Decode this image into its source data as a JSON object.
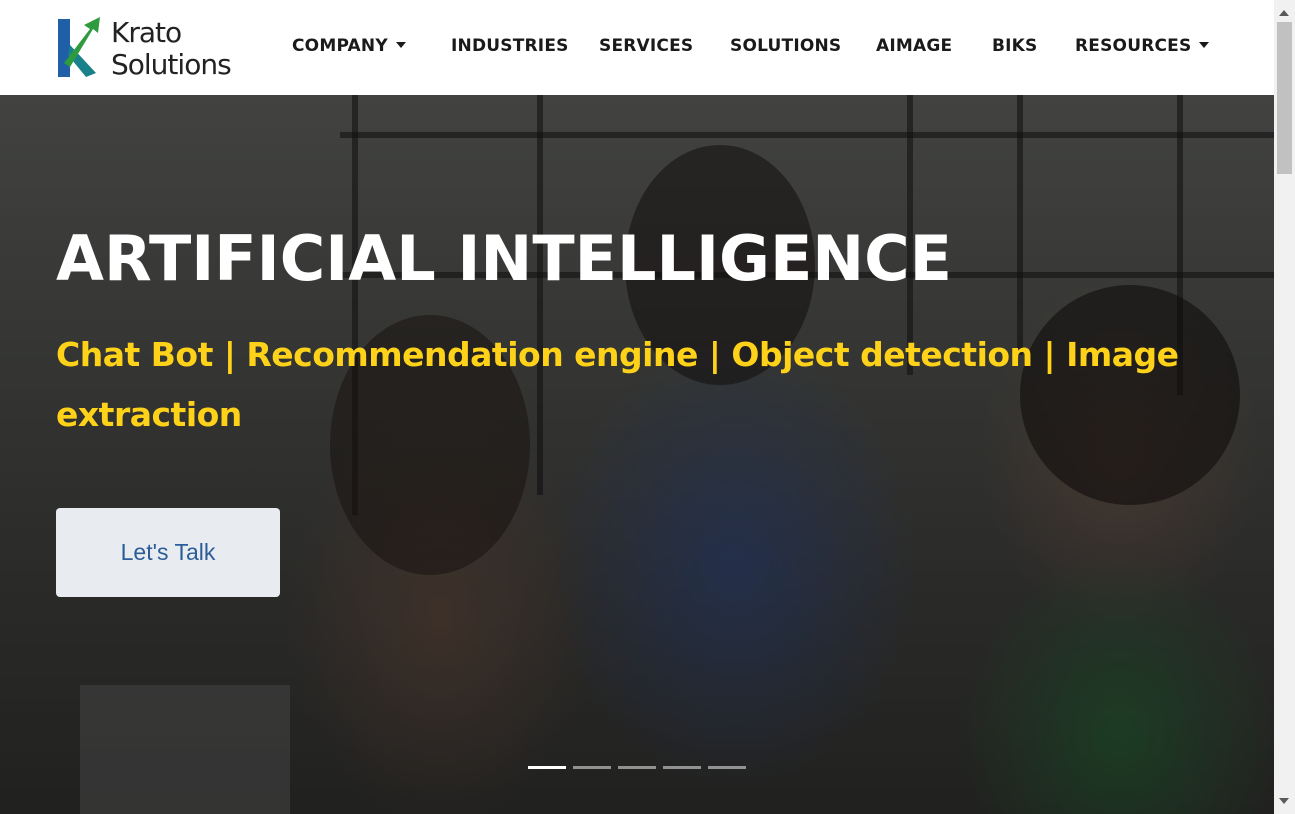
{
  "brand": {
    "name_line1": "Krato",
    "name_line2": "Solutions",
    "colors": {
      "green": "#2e9b3e",
      "blue": "#1f5fa8",
      "teal": "#18818a"
    }
  },
  "nav": {
    "items": [
      {
        "label": "COMPANY",
        "dropdown": true
      },
      {
        "label": "INDUSTRIES",
        "dropdown": false
      },
      {
        "label": "SERVICES",
        "dropdown": false
      },
      {
        "label": "SOLUTIONS",
        "dropdown": false
      },
      {
        "label": "AIMAGE",
        "dropdown": false
      },
      {
        "label": "BIKS",
        "dropdown": false
      },
      {
        "label": "RESOURCES",
        "dropdown": true
      }
    ]
  },
  "hero": {
    "title": "ARTIFICIAL INTELLIGENCE",
    "subtitle": "Chat Bot | Recommendation engine | Object detection | Image extraction",
    "cta_label": "Let's Talk",
    "slide_count": 5,
    "active_slide": 1,
    "colors": {
      "title": "#ffffff",
      "subtitle": "#ffd21a",
      "cta_bg": "#e8ecf1",
      "cta_text": "#2b5d98"
    }
  }
}
